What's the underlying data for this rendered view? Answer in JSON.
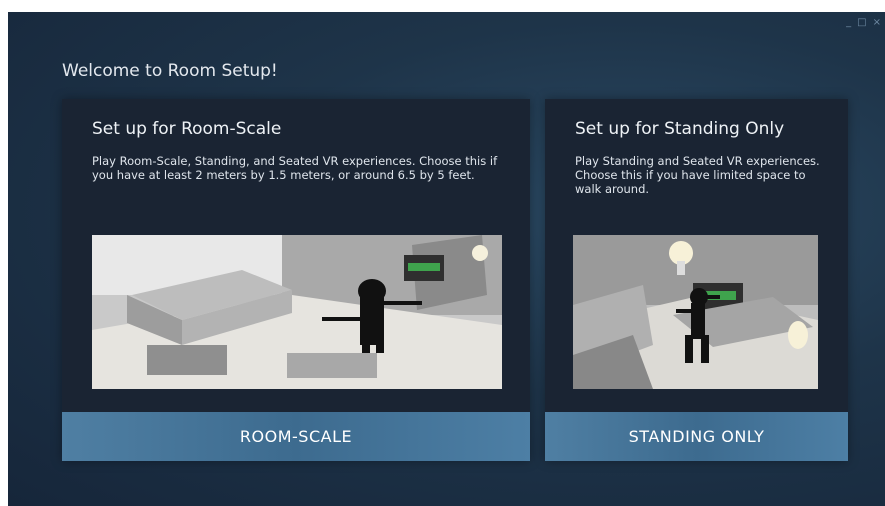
{
  "window": {
    "title": "Welcome to Room Setup!",
    "controls": {
      "minimize": "_",
      "maximize": "□",
      "close": "×"
    }
  },
  "options": [
    {
      "heading": "Set up for Room-Scale",
      "description": "Play Room-Scale, Standing, and Seated VR experiences. Choose this if you have at least 2 meters by 1.5 meters, or around 6.5 by 5 feet.",
      "button_label": "ROOM-SCALE"
    },
    {
      "heading": "Set up for Standing Only",
      "description": "Play Standing and Seated VR experiences. Choose this if you have limited space to walk around.",
      "button_label": "STANDING ONLY"
    }
  ],
  "colors": {
    "background": "#1e3449",
    "card": "#1a2433",
    "button": "#4a7aa0",
    "text": "#e3e8ee"
  },
  "icons": [
    "minimize-icon",
    "maximize-icon",
    "close-icon"
  ]
}
